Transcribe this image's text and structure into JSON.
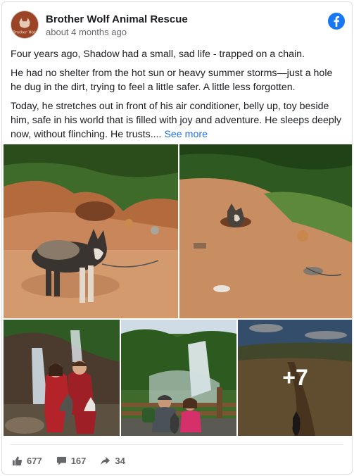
{
  "post": {
    "page_name": "Brother Wolf Animal Rescue",
    "timestamp": "about 4 months ago",
    "avatar_text": "Brother Wolf",
    "paragraphs": [
      "Four years ago, Shadow had a small, sad life - trapped on a chain.",
      "He had no shelter from the hot sun or heavy summer storms—just a hole he dug in the dirt, trying to feel a little safer. A little less forgotten.",
      "Today, he stretches out in front of his air conditioner, belly up, toy beside him, safe in his world that is filled with joy and adventure. He sleeps deeply now, without flinching. He trusts...."
    ],
    "see_more": "See more",
    "more_photos": "+7"
  },
  "stats": {
    "likes": "677",
    "comments": "167",
    "shares": "34"
  },
  "icons": {
    "brand": "facebook-icon",
    "like": "thumbs-up-icon",
    "comment": "comment-icon",
    "share": "share-arrow-icon"
  },
  "colors": {
    "facebook_blue": "#1877f2",
    "link_blue": "#216fdb",
    "muted": "#65676b"
  }
}
